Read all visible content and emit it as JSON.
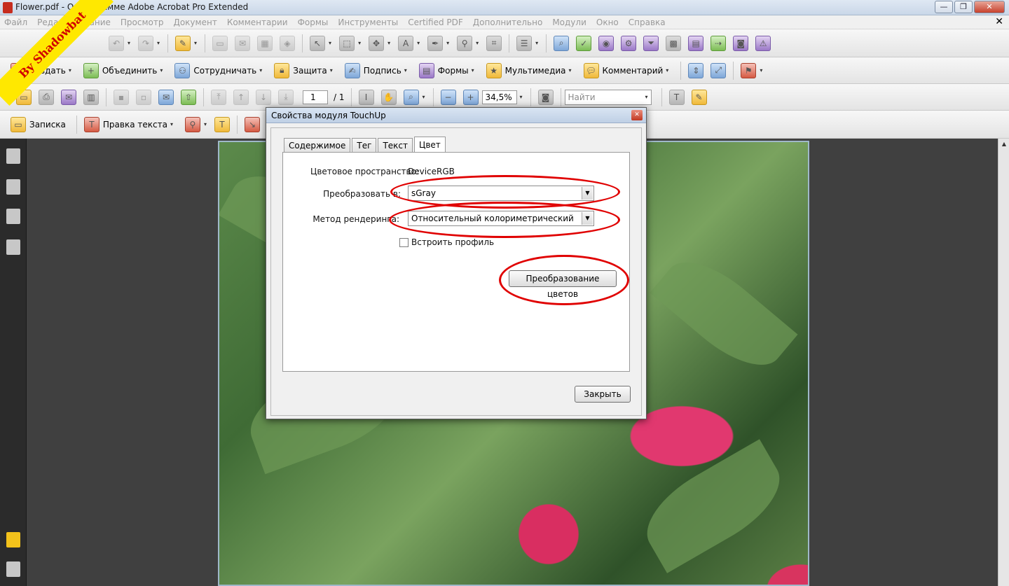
{
  "window": {
    "title": "Flower.pdf - О программе Adobe Acrobat Pro Extended",
    "minimize": "0",
    "maximize": "1",
    "close": "x"
  },
  "menu": [
    "Файл",
    "Редактирование",
    "Просмотр",
    "Документ",
    "Комментарии",
    "Формы",
    "Инструменты",
    "Certified PDF",
    "Дополнительно",
    "Модули",
    "Окно",
    "Справка"
  ],
  "watermark": "By Shadowbat",
  "toolbar2": {
    "create": "Создать",
    "combine": "Объединить",
    "collaborate": "Сотрудничать",
    "secure": "Защита",
    "sign": "Подпись",
    "forms": "Формы",
    "multimedia": "Мультимедиа",
    "comment": "Комментарий"
  },
  "toolbar3": {
    "page_current": "1",
    "page_total": "/ 1",
    "zoom": "34,5%",
    "find_placeholder": "Найти"
  },
  "toolbar4": {
    "note": "Записка",
    "edit_text": "Правка текста"
  },
  "dialog": {
    "title": "Свойства модуля TouchUp",
    "tabs": [
      "Содержимое",
      "Тег",
      "Текст",
      "Цвет"
    ],
    "active_tab": "Цвет",
    "color_space_label": "Цветовое пространство:",
    "color_space_value": "DeviceRGB",
    "convert_label": "Преобразовать в:",
    "convert_value": "sGray",
    "render_label": "Метод рендеринга:",
    "render_value": "Относительный колориметрический",
    "embed_profile": "Встроить профиль",
    "convert_button": "Преобразование цветов",
    "close_button": "Закрыть"
  },
  "colors": {
    "highlight_ring": "#e00000",
    "watermark_bg": "#ffe800",
    "watermark_text": "#d10000"
  }
}
